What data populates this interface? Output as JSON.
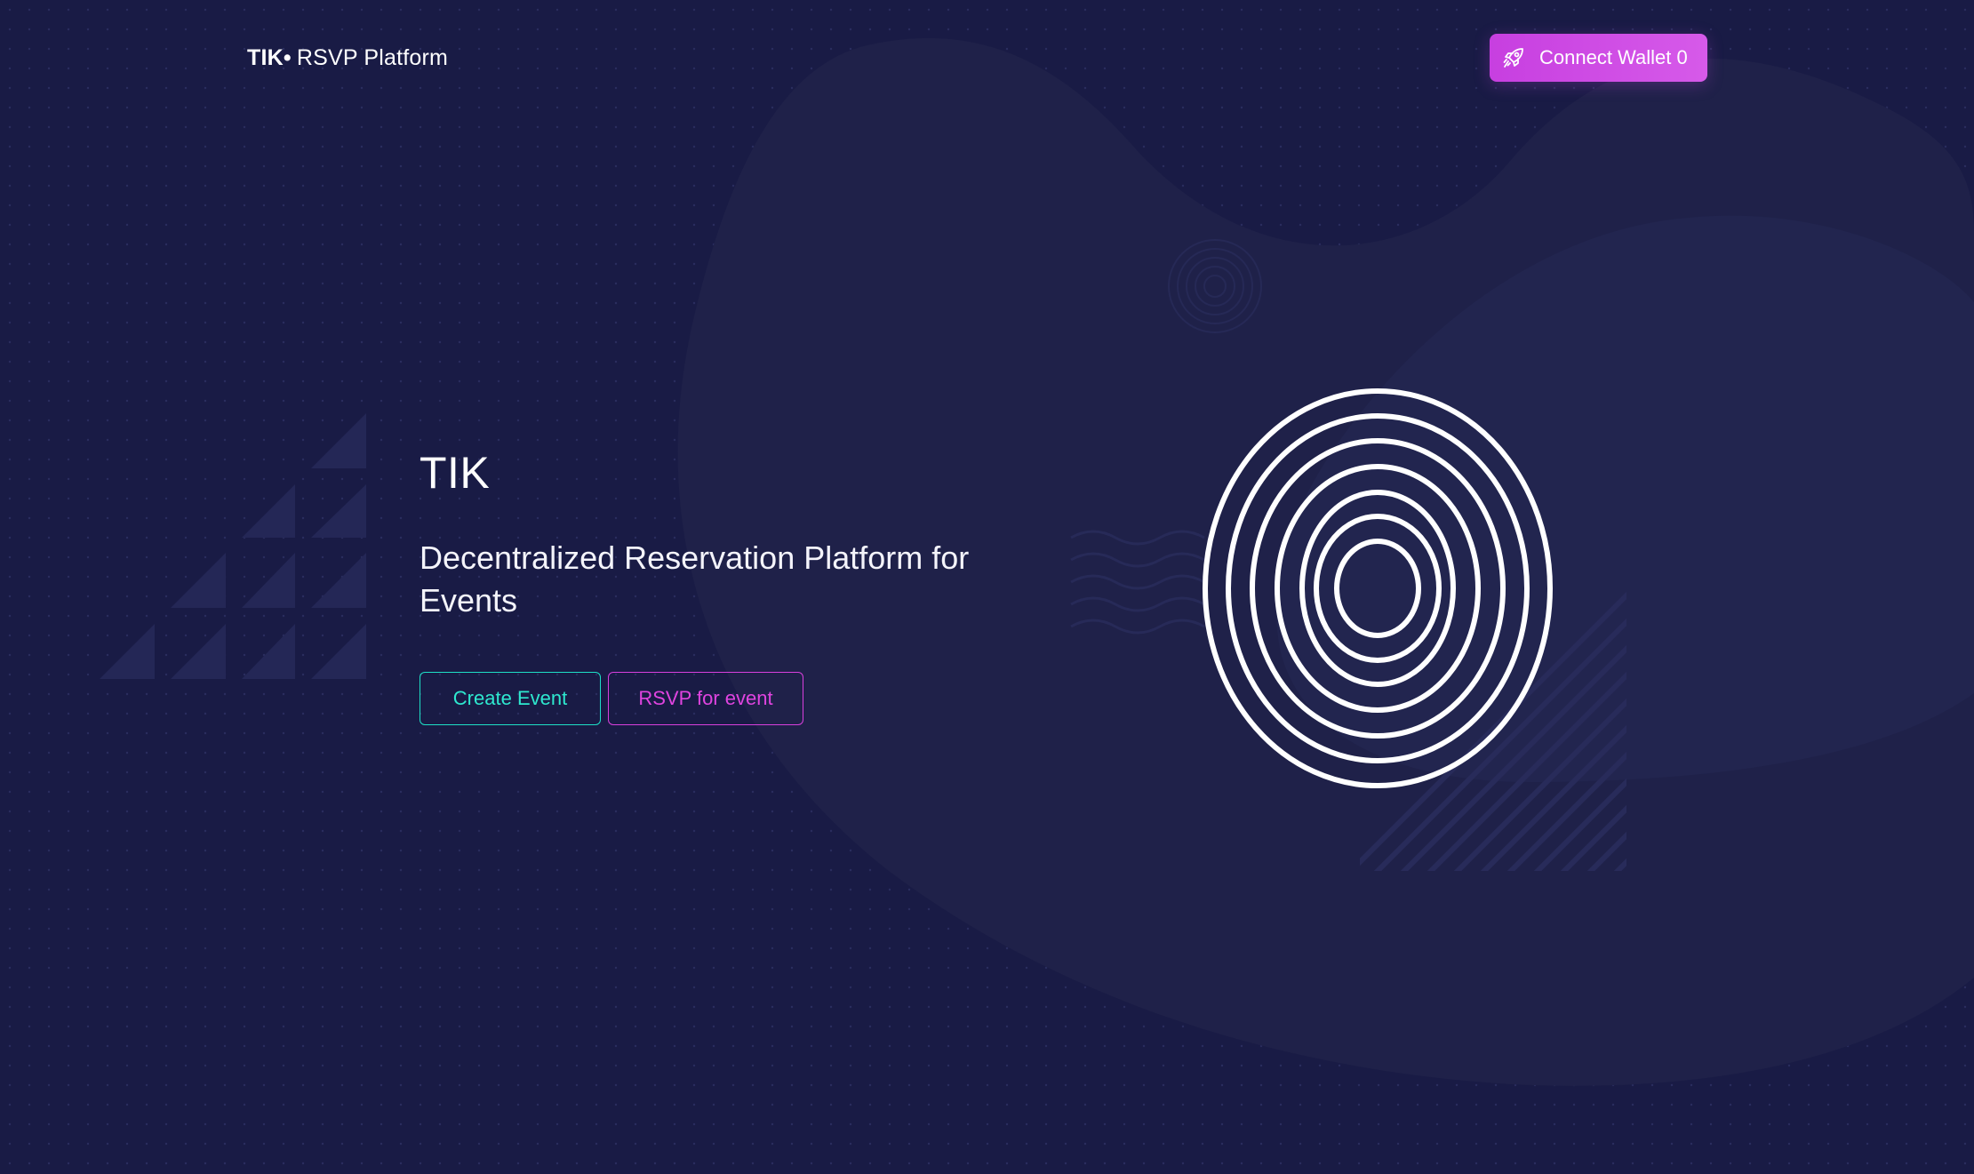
{
  "header": {
    "brand_strong": "TIK",
    "brand_dot": "•",
    "brand_rest": "RSVP Platform",
    "connect_button": {
      "icon": "rocket-icon",
      "label": "Connect Wallet 0"
    }
  },
  "hero": {
    "title": "TIK",
    "subtitle": "Decentralized Reservation Platform for Events",
    "actions": {
      "create_label": "Create Event",
      "rsvp_label": "RSVP for event"
    }
  },
  "colors": {
    "background": "#191b45",
    "blob": "#1f2149",
    "accent_teal": "#1ee0c6",
    "accent_magenta": "#d83fdc",
    "button_gradient_start": "#c73fe0",
    "button_gradient_end": "#d65ae9",
    "text": "#ffffff"
  }
}
